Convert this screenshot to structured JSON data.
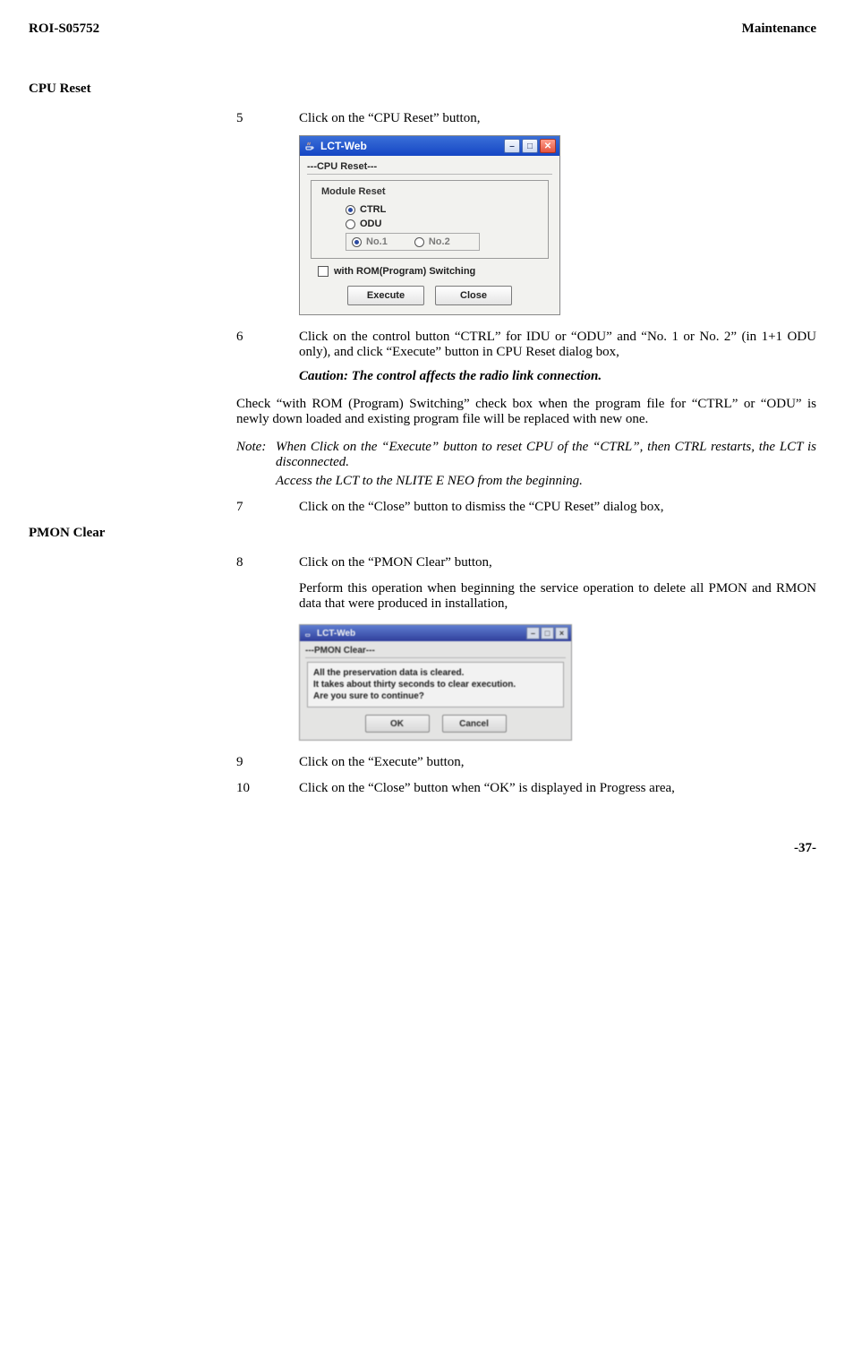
{
  "header": {
    "left": "ROI-S05752",
    "right": "Maintenance"
  },
  "sections": {
    "cpu_reset_heading": "CPU Reset",
    "pmon_clear_heading": "PMON Clear"
  },
  "steps": {
    "s5": {
      "num": "5",
      "text": "Click on the “CPU Reset” button,"
    },
    "s6": {
      "num": "6",
      "text": "Click on the control button “CTRL” for IDU or “ODU” and “No. 1 or No. 2” (in 1+1 ODU only), and click “Execute” button in CPU Reset dialog box,"
    },
    "s7": {
      "num": "7",
      "text": "Click on the “Close” button to dismiss the “CPU Reset” dialog box,"
    },
    "s8": {
      "num": "8",
      "text": "Click on the “PMON Clear” button,"
    },
    "s8_extra": "Perform this operation when beginning the service operation to delete all PMON and RMON data that were produced in installation,",
    "s9": {
      "num": "9",
      "text": "Click on the “Execute” button,"
    },
    "s10": {
      "num": "10",
      "text": "Click on the “Close” button when “OK” is displayed in Progress area,"
    }
  },
  "caution": "Caution: The control affects the radio link connection.",
  "rom_para": "Check “with ROM (Program) Switching” check box when the program file for “CTRL” or “ODU” is newly down loaded and existing program file will be replaced with new one.",
  "note": {
    "label": "Note:",
    "line1": "When Click on the “Execute” button to reset CPU of the “CTRL”, then CTRL restarts, the LCT is disconnected.",
    "line2": "Access the LCT to the NLITE E NEO from the beginning."
  },
  "dlg1": {
    "title": "LCT-Web",
    "panel": "---CPU Reset---",
    "groupbox": "Module Reset",
    "radio_ctrl": "CTRL",
    "radio_odu": "ODU",
    "radio_no1": "No.1",
    "radio_no2": "No.2",
    "chk_label": "with ROM(Program) Switching",
    "btn_execute": "Execute",
    "btn_close": "Close"
  },
  "dlg2": {
    "title": "LCT-Web",
    "panel": "---PMON Clear---",
    "line1": "All the preservation data is cleared.",
    "line2": "It takes about thirty seconds to clear execution.",
    "line3": "Are you sure to continue?",
    "btn_ok": "OK",
    "btn_cancel": "Cancel"
  },
  "page_number": "-37-"
}
